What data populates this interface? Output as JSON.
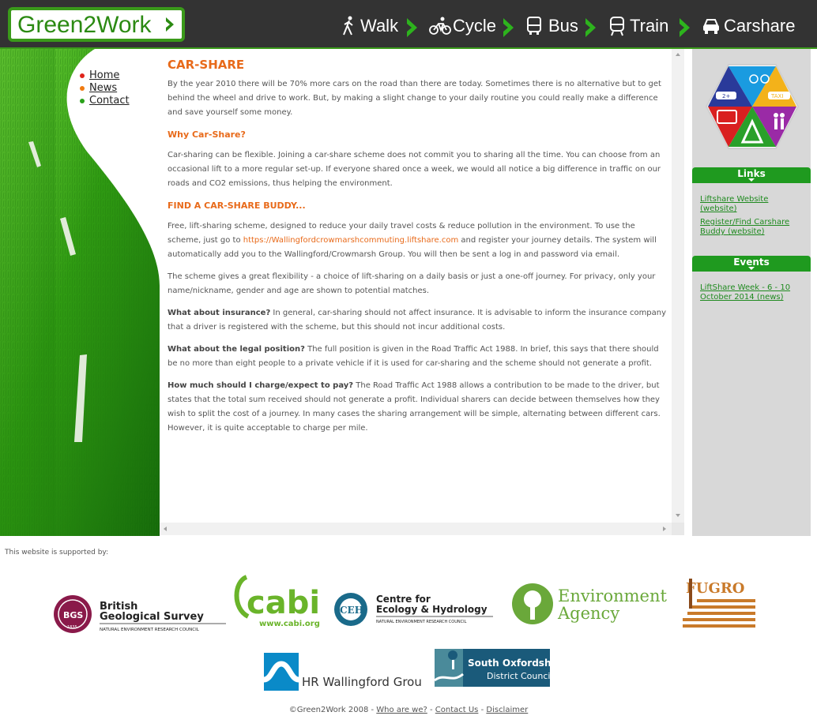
{
  "header": {
    "logo_text": "Green2Work",
    "nav": [
      "Walk",
      "Cycle",
      "Bus",
      "Train",
      "Carshare"
    ]
  },
  "left_nav": [
    "Home",
    "News",
    "Contact"
  ],
  "left_nav_dot_colors": [
    "#e0241b",
    "#f07a10",
    "#2aa11a"
  ],
  "content": {
    "title": "CAR-SHARE",
    "intro": "By the year 2010 there will be 70% more cars on the road than there are today. Sometimes there is no alternative but to get behind the wheel and drive to work. But, by making a slight change to your daily routine you could really make a difference and save yourself some money.",
    "why_heading": "Why Car-Share?",
    "why_text": "Car-sharing can be flexible. Joining a car-share scheme does not commit you to sharing all the time. You can choose from an occasional lift to a more regular set-up. If everyone shared once a week, we would all notice a big difference in traffic on our roads and CO2 emissions, thus helping the environment.",
    "find_heading": "FIND A CAR-SHARE BUDDY...",
    "find_text_a": "Free, lift-sharing scheme, designed to reduce your daily travel costs & reduce pollution in the environment. To use the scheme, just go to ",
    "find_link": "https://Wallingfordcrowmarshcommuting.liftshare.com",
    "find_text_b": " and register your journey details. The system will automatically add you to the Wallingford/Crowmarsh Group. You will then be sent a log in and password via email.",
    "flex_text": "The scheme gives a great flexibility - a choice of lift-sharing on a daily basis or just a one-off journey. For privacy, only your name/nickname, gender and age are shown to potential matches.",
    "ins_q": "What about insurance?",
    "ins_text": " In general, car-sharing should not affect insurance. It is advisable to inform the insurance company that a driver is registered with the scheme, but this should not incur additional costs.",
    "legal_q": "What about the legal position?",
    "legal_text": " The full position is given in the Road Traffic Act 1988. In brief, this says that there should be no more than eight people to a private vehicle if it is used for car-sharing and the scheme should not generate a profit.",
    "charge_q": "How much should I charge/expect to pay?",
    "charge_text": " The Road Traffic Act 1988 allows a contribution to be made to the driver, but states that the total sum received should not generate a profit. Individual sharers can decide between themselves how they wish to split the cost of a journey. In many cases the sharing arrangement will be simple, alternating between different cars. However, it is quite acceptable to charge per mile."
  },
  "sidebar": {
    "badge_labels": [
      "2+",
      "TAXI"
    ],
    "links_heading": "Links",
    "links": [
      "Liftshare Website (website)",
      "Register/Find Carshare Buddy (website)"
    ],
    "events_heading": "Events",
    "events": [
      "LiftShare Week - 6 - 10 October 2014 (news)"
    ]
  },
  "footer": {
    "supported": "This website is supported by:",
    "logos": {
      "bgs_badge": "BGS",
      "bgs_year": "1835",
      "bgs_1": "British",
      "bgs_2": "Geological Survey",
      "bgs_3": "NATURAL ENVIRONMENT RESEARCH COUNCIL",
      "cabi_mark": "cabi",
      "cabi_url": "www.cabi.org",
      "ceh_badge": "CEH",
      "ceh_1": "Centre for",
      "ceh_2": "Ecology & Hydrology",
      "ceh_3": "NATURAL ENVIRONMENT RESEARCH COUNCIL",
      "ea_1": "Environment",
      "ea_2": "Agency",
      "fugro": "FUGRO",
      "hr": "HR Wallingford Group",
      "so_1": "South Oxfordshire",
      "so_2": "District Council"
    },
    "copyright": "©Green2Work 2008 - ",
    "links": [
      "Who are we?",
      "Contact Us",
      "Disclaimer"
    ],
    "sep": " - "
  },
  "colors": {
    "accent_orange": "#e86a1a",
    "brand_green": "#3a9a1a",
    "header_bg": "#333333"
  }
}
